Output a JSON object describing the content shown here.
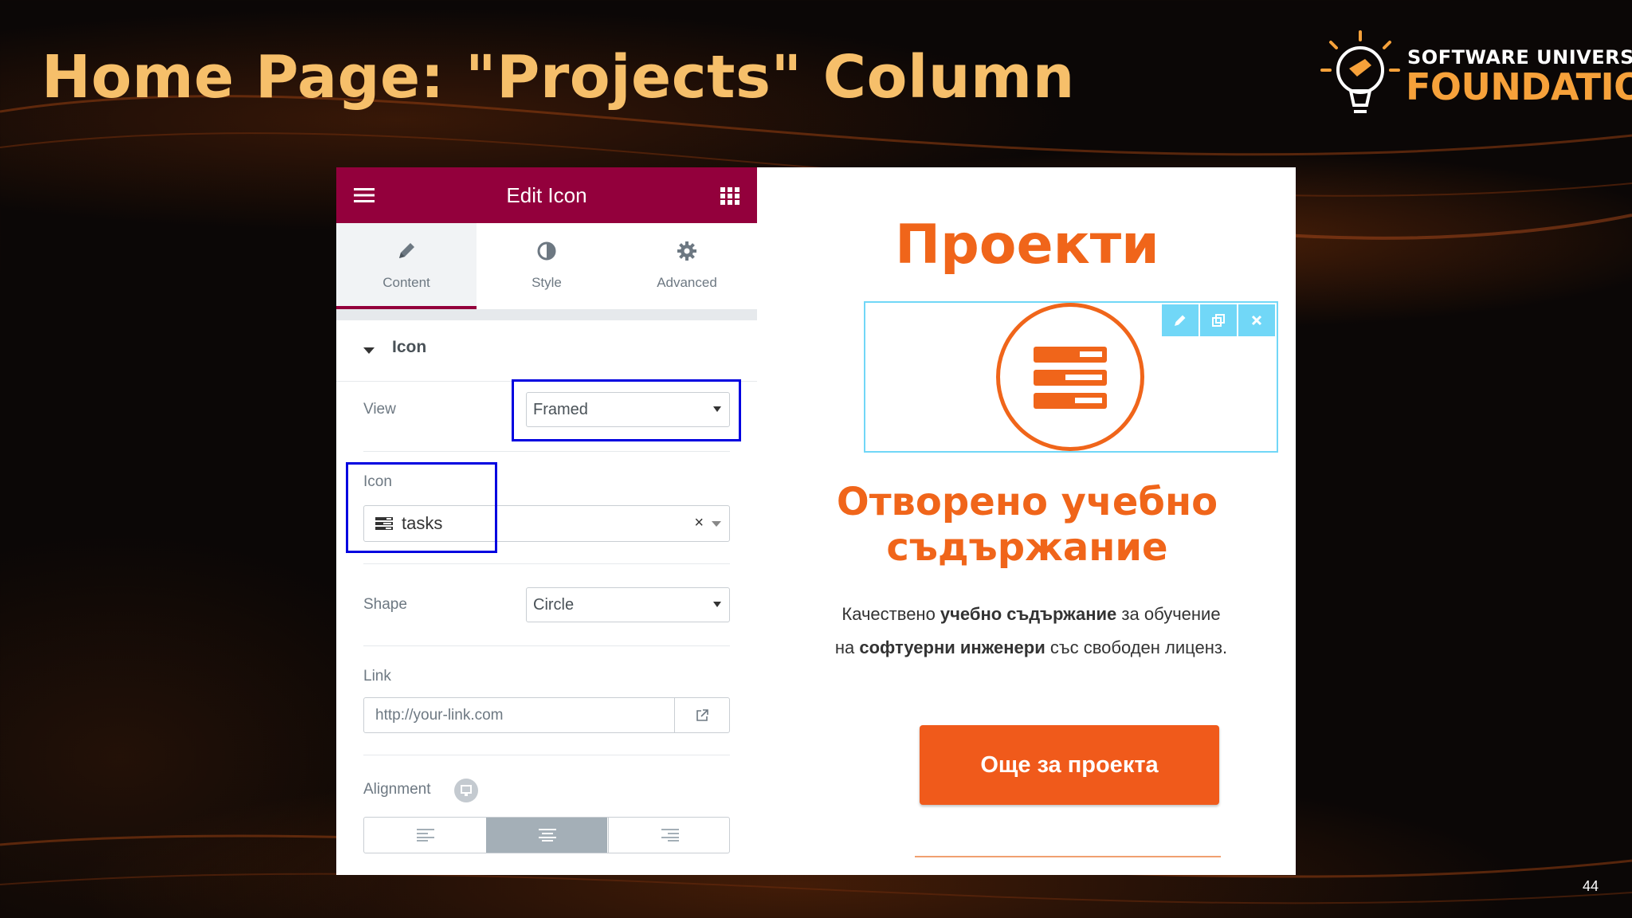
{
  "slide": {
    "title": "Home Page: \"Projects\" Column",
    "page_number": "44"
  },
  "logo": {
    "line1": "SOFTWARE UNIVERSITY",
    "line2": "FOUNDATION",
    "accent_color": "#f6a13a"
  },
  "editor": {
    "header": {
      "title": "Edit Icon",
      "menu_icon": "hamburger-icon",
      "widgets_icon": "grid-icon",
      "color": "#93003c"
    },
    "tabs": [
      {
        "label": "Content",
        "icon": "pencil-icon",
        "active": true
      },
      {
        "label": "Style",
        "icon": "half-circle-icon",
        "active": false
      },
      {
        "label": "Advanced",
        "icon": "gear-icon",
        "active": false
      }
    ],
    "section": {
      "title": "Icon"
    },
    "fields": {
      "view": {
        "label": "View",
        "value": "Framed"
      },
      "icon": {
        "label": "Icon",
        "value": "tasks"
      },
      "shape": {
        "label": "Shape",
        "value": "Circle"
      },
      "link": {
        "label": "Link",
        "placeholder": "http://your-link.com"
      },
      "alignment": {
        "label": "Alignment",
        "options": [
          "left",
          "center",
          "right"
        ],
        "selected": "center"
      }
    }
  },
  "preview": {
    "heading": "Проекти",
    "subheading_line1": "Отворено учебно",
    "subheading_line2": "съдържание",
    "text": {
      "p1": "Качествено ",
      "b1": "учебно съдържание",
      "p2": " за обучение на ",
      "b2": "софтуерни инженери",
      "p3": " със свободен лиценз."
    },
    "button": "Още за проекта",
    "accent_color": "#f0651a",
    "widget_tools": [
      "edit-icon",
      "duplicate-icon",
      "delete-icon"
    ]
  }
}
